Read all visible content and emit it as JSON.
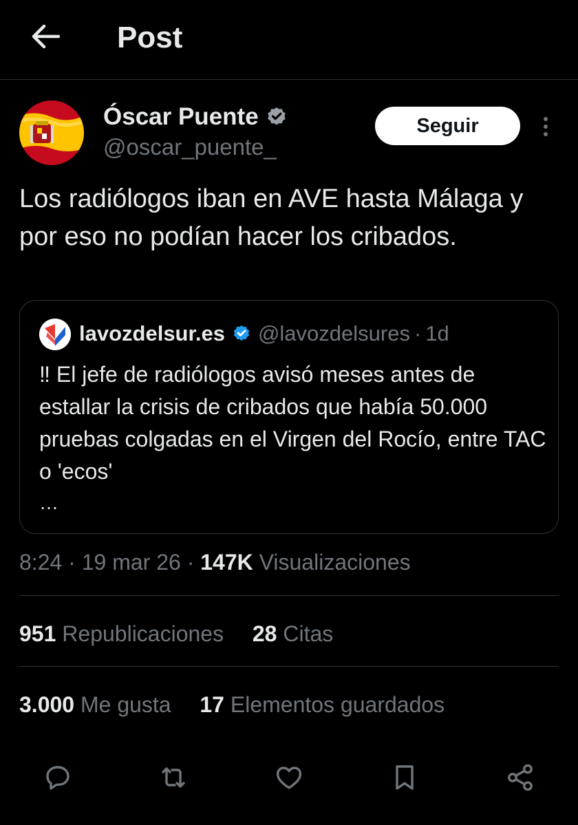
{
  "header": {
    "title": "Post",
    "back_icon": "arrow-left-icon"
  },
  "post": {
    "author_name": "Óscar Puente",
    "author_handle": "@oscar_puente_",
    "follow_label": "Seguir",
    "text": "Los radiólogos iban en AVE hasta Málaga y por eso no podían hacer los cribados.",
    "timestamp_time": "8:24",
    "timestamp_date": "19 mar 26",
    "views_count": "147K",
    "views_label": "Visualizaciones"
  },
  "quote": {
    "name": "lavozdelsur.es",
    "handle": "@lavozdelsures",
    "separator": "·",
    "time": "1d",
    "text": "‼ El jefe de radiólogos avisó meses antes de estallar la crisis de cribados que había 50.000 pruebas colgadas en el Virgen del Rocío, entre TAC o 'ecos'",
    "ellipsis": "…"
  },
  "stats": {
    "reposts_count": "951",
    "reposts_label": "Republicaciones",
    "quotes_count": "28",
    "quotes_label": "Citas",
    "likes_count": "3.000",
    "likes_label": "Me gusta",
    "bookmarks_count": "17",
    "bookmarks_label": "Elementos guardados"
  },
  "actions": [
    "reply-icon",
    "repost-icon",
    "like-icon",
    "bookmark-icon",
    "share-icon"
  ],
  "colors": {
    "background": "#000000",
    "text_primary": "#e7e9ea",
    "text_secondary": "#71767b",
    "divider": "#2f3336",
    "verified": "#1d9bf0",
    "follow_button_bg": "#ffffff"
  }
}
